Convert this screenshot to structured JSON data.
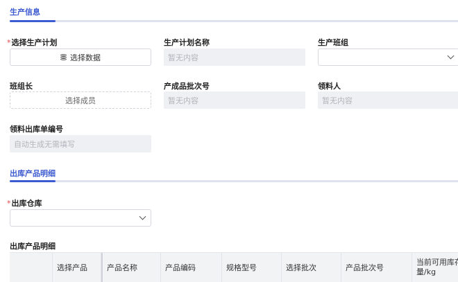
{
  "sections": {
    "production_info": "生产信息",
    "outbound_detail": "出库产品明细"
  },
  "form": {
    "select_plan": {
      "required_mark": "*",
      "label": "选择生产计划",
      "button": "选择数据"
    },
    "plan_name": {
      "label": "生产计划名称",
      "placeholder": "暂无内容"
    },
    "production_team": {
      "label": "生产班组"
    },
    "team_leader": {
      "label": "班组长",
      "button": "选择成员"
    },
    "batch_no": {
      "label": "产成品批次号",
      "placeholder": "暂无内容"
    },
    "receiver": {
      "label": "领料人",
      "placeholder": "暂无内容"
    },
    "outbound_no": {
      "label": "领料出库单编号",
      "placeholder": "自动生成无需填写"
    },
    "warehouse": {
      "required_mark": "*",
      "label": "出库仓库"
    },
    "detail_label": "出库产品明细"
  },
  "table": {
    "columns": [
      "",
      "选择产品",
      "产品名称",
      "产品编码",
      "规格型号",
      "选择批次",
      "产品批次号",
      "当前可用库存量/kg"
    ]
  },
  "icons": {
    "database": "database-icon",
    "dropdown": "chevron-down-icon"
  },
  "colors": {
    "accent": "#3d5bd1",
    "required": "#e5484d",
    "readonly_bg": "#eef0f3"
  }
}
